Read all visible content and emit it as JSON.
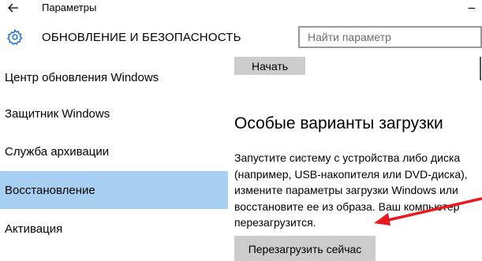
{
  "window": {
    "title": "Параметры",
    "back_icon": "arrow-left-icon",
    "close_icon": "close-icon"
  },
  "header": {
    "icon": "gear-icon",
    "title": "ОБНОВЛЕНИЕ И БЕЗОПАСНОСТЬ",
    "search_placeholder": "Найти параметр"
  },
  "sidebar": {
    "items": [
      {
        "label": "Центр обновления Windows",
        "active": false
      },
      {
        "label": "Защитник Windows",
        "active": false
      },
      {
        "label": "Служба архивации",
        "active": false
      },
      {
        "label": "Восстановление",
        "active": true
      },
      {
        "label": "Активация",
        "active": false
      }
    ]
  },
  "main": {
    "start_button": "Начать",
    "section_heading": "Особые варианты загрузки",
    "description_lines": [
      "Запустите систему с устройства либо диска",
      "(например, USB-накопителя или DVD-диска),",
      "измените параметры загрузки Windows или",
      "восстановите ее из образа. Ваш компьютер",
      "перезагрузится."
    ],
    "restart_button": "Перезагрузить сейчас"
  },
  "colors": {
    "accent": "#1e6fd6",
    "active_item_bg": "#a6cff2",
    "button_bg": "#cccccc",
    "annotation_arrow": "#e8191f"
  }
}
